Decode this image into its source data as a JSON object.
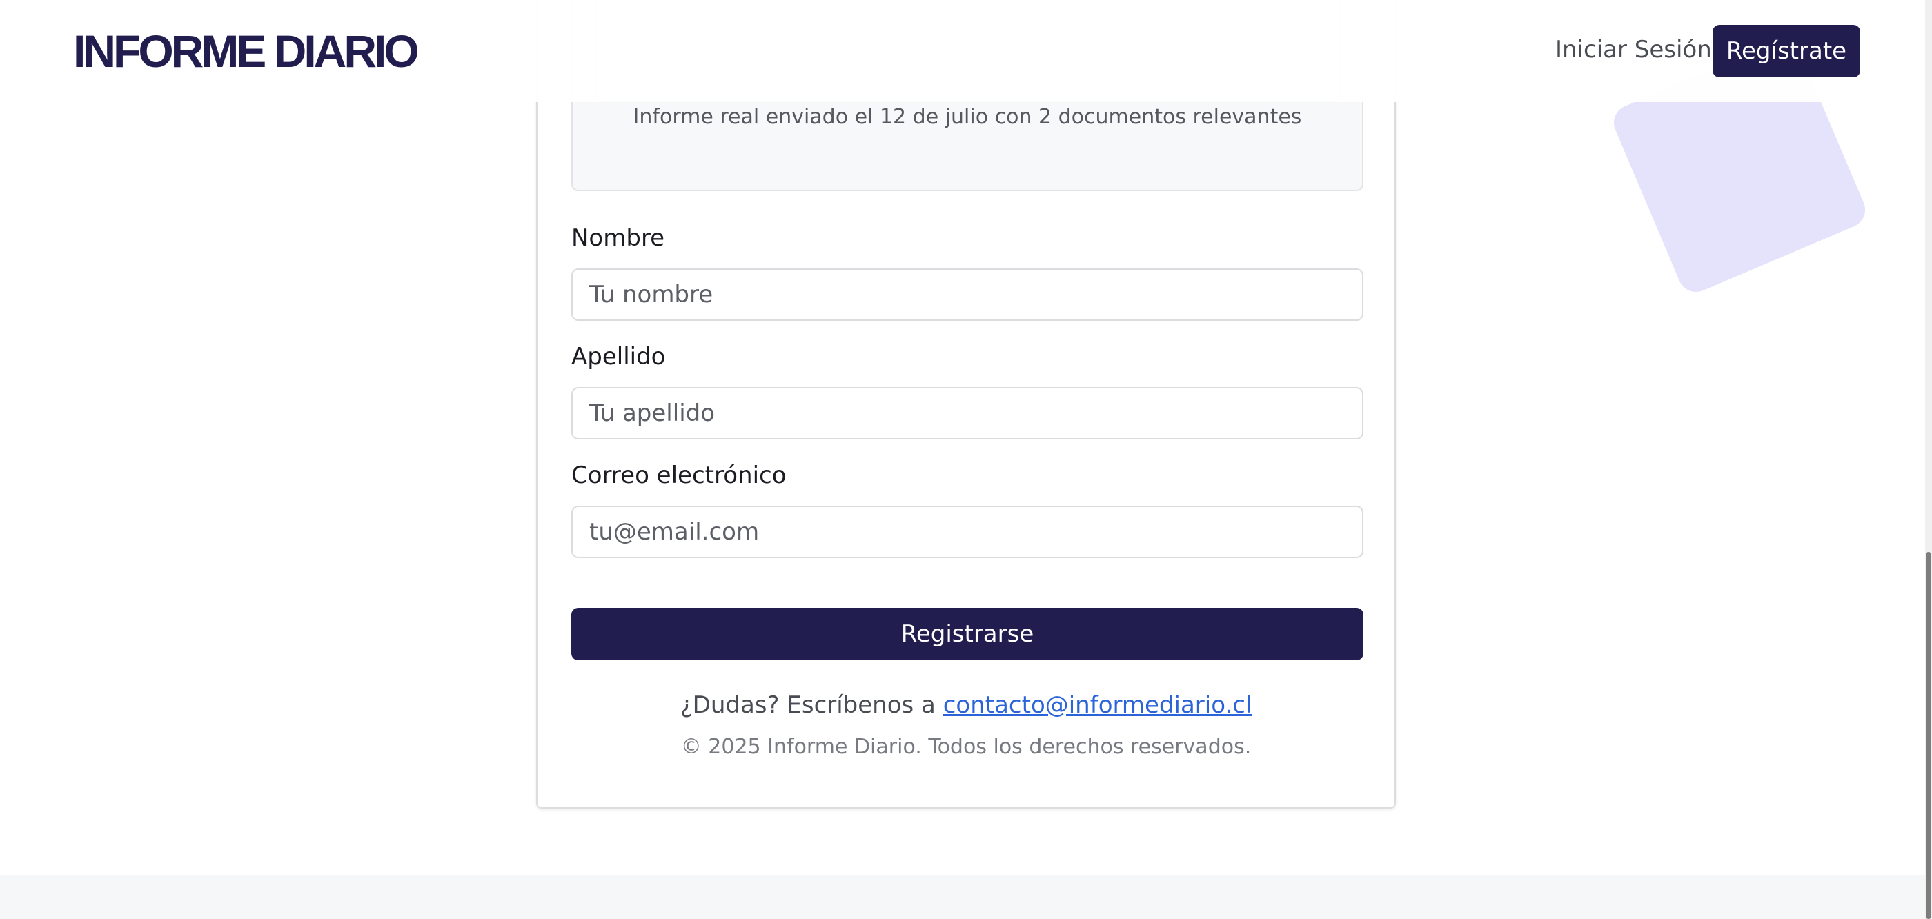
{
  "header": {
    "logo": "INFORME DIARIO",
    "login_label": "Iniciar Sesión",
    "register_label": "Regístrate"
  },
  "preview": {
    "caption": "Informe real enviado el 12 de julio con 2 documentos relevantes"
  },
  "form": {
    "first_name_label": "Nombre",
    "first_name_placeholder": "Tu nombre",
    "last_name_label": "Apellido",
    "last_name_placeholder": "Tu apellido",
    "email_label": "Correo electrónico",
    "email_placeholder": "tu@email.com",
    "submit_label": "Registrarse"
  },
  "footer": {
    "contact_prefix": "¿Dudas? Escríbenos a ",
    "contact_email": "contacto@informediario.cl",
    "copyright": "© 2025 Informe Diario. Todos los derechos reservados."
  },
  "colors": {
    "brand": "#211d4e",
    "link": "#2a64d8",
    "decoration": "#e4e3fb"
  }
}
